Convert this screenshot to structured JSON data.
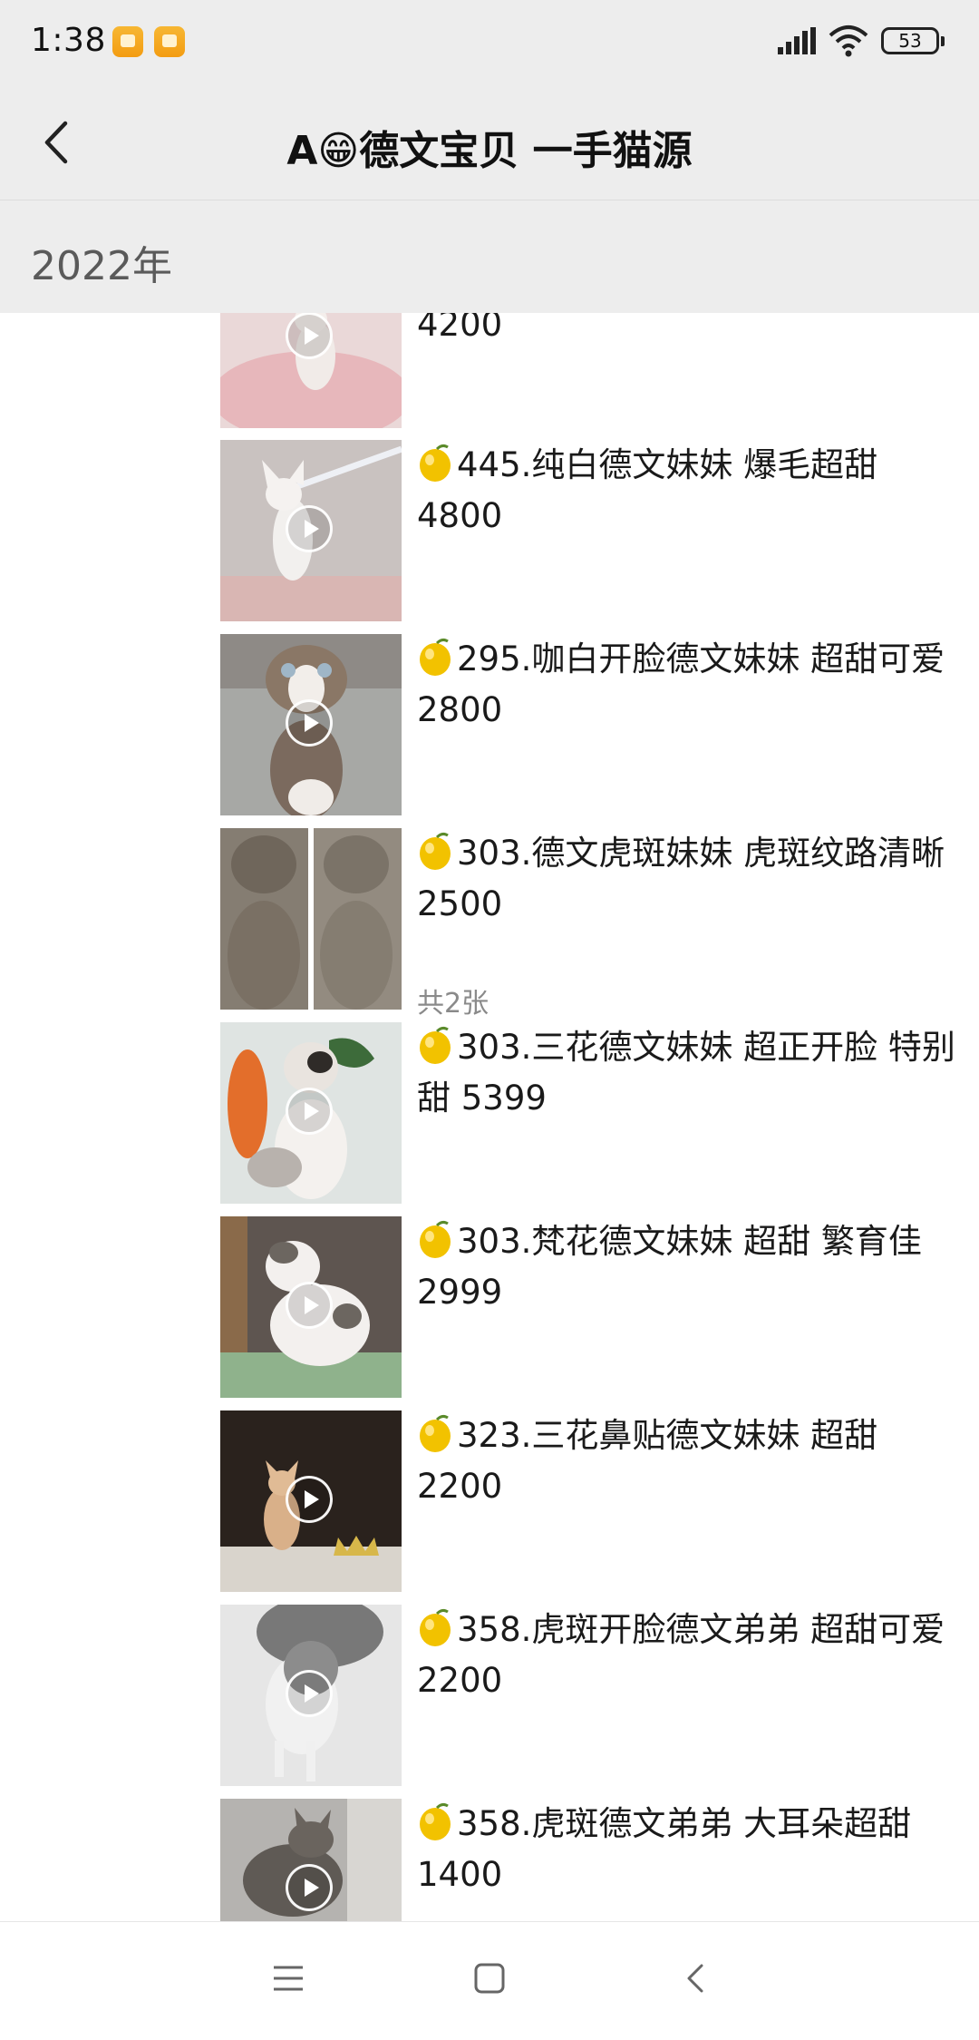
{
  "status_bar": {
    "time": "1:38",
    "battery": "53",
    "icons": [
      "notification-icon",
      "notification-icon",
      "signal-icon",
      "wifi-icon",
      "battery-icon"
    ]
  },
  "header": {
    "title": "A😁德文宝贝 一手猫源",
    "back_icon": "chevron-left-icon"
  },
  "section": {
    "label": "2022年"
  },
  "items": [
    {
      "number": "",
      "text": "4200",
      "thumb": "kitten-pink-bed",
      "count": ""
    },
    {
      "number": "445",
      "text": "445.纯白德文妹妹 爆毛超甜 4800",
      "thumb": "kitten-white-wand",
      "count": ""
    },
    {
      "number": "295",
      "text": "295.咖白开脸德文妹妹 超甜可爱 2800",
      "thumb": "kitten-brown-white",
      "count": ""
    },
    {
      "number": "303",
      "text": "303.德文虎斑妹妹 虎斑纹路清晰 2500",
      "thumb": "kittens-tabby-two",
      "count": "共2张"
    },
    {
      "number": "303",
      "text": "303.三花德文妹妹 超正开脸 特别甜 5399",
      "thumb": "kitten-calico-carrot",
      "count": ""
    },
    {
      "number": "303",
      "text": "303.梵花德文妹妹 超甜 繁育佳 2999",
      "thumb": "kitten-van-pattern",
      "count": ""
    },
    {
      "number": "323",
      "text": "323.三花鼻贴德文妹妹 超甜 2200",
      "thumb": "kitten-dark-room",
      "count": ""
    },
    {
      "number": "358",
      "text": "358.虎斑开脸德文弟弟 超甜可爱 2200",
      "thumb": "kitten-grey-floor",
      "count": ""
    },
    {
      "number": "358",
      "text": "358.虎斑德文弟弟 大耳朵超甜 1400",
      "thumb": "kitten-grey-tabby",
      "count": ""
    }
  ],
  "nav_bar": {
    "buttons": [
      "menu-icon",
      "home-icon",
      "back-icon"
    ]
  },
  "colors": {
    "header_bg": "#ededed",
    "page_bg": "#ffffff",
    "text": "#1a1a1a",
    "muted": "#8a8a8a",
    "lemon": "#f2c200"
  }
}
